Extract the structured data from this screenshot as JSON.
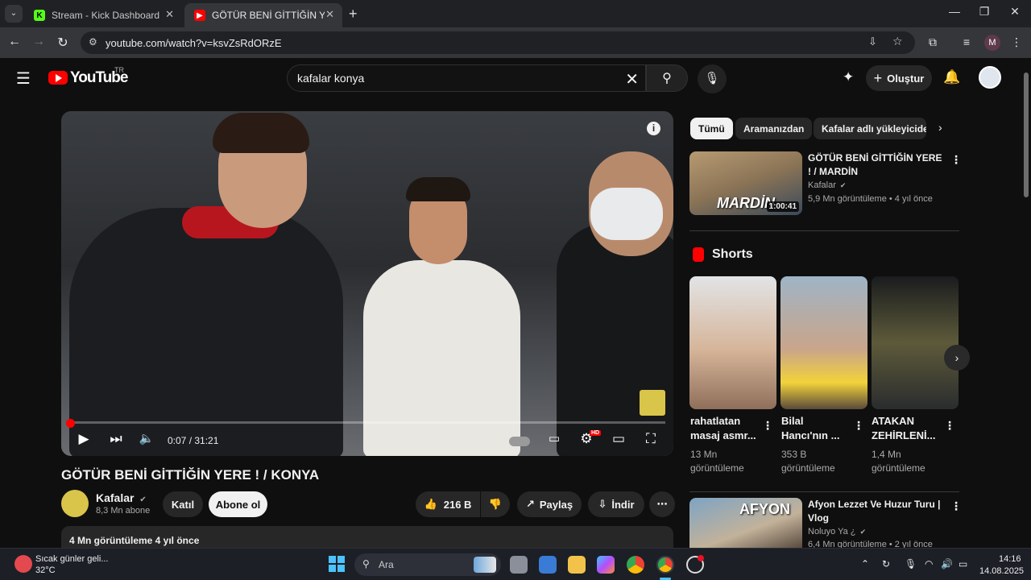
{
  "browser": {
    "tabs": [
      {
        "title": "Stream - Kick Dashboard",
        "icon": "kick-icon"
      },
      {
        "title": "GÖTÜR BENİ GİTTİĞİN YERE ! / KONYA",
        "icon": "youtube-icon"
      }
    ],
    "new_tab": "+",
    "url": "youtube.com/watch?v=ksvZsRdORzE",
    "profile_initial": "M"
  },
  "youtube": {
    "logo_text": "YouTube",
    "country_code": "TR",
    "search_query": "kafalar konya",
    "create_label": "Oluştur"
  },
  "player": {
    "time": "0:07 / 31:21",
    "progress_fraction": 0.004,
    "hd_badge": "HD"
  },
  "video": {
    "title": "GÖTÜR BENİ GİTTİĞİN YERE ! / KONYA",
    "channel": "Kafalar",
    "subscribers": "8,3 Mn abone",
    "join_label": "Katıl",
    "subscribe_label": "Abone ol",
    "likes": "216 B",
    "share_label": "Paylaş",
    "download_label": "İndir",
    "views_date": "4 Mn görüntüleme  4 yıl önce"
  },
  "sidebar": {
    "chips": [
      "Tümü",
      "Aramanızdan",
      "Kafalar adlı yükleyiciden"
    ],
    "recommended": [
      {
        "title": "GÖTÜR BENİ GİTTİĞİN YERE ! / MARDİN",
        "channel": "Kafalar",
        "meta": "5,9 Mn görüntüleme • 4 yıl önce",
        "duration": "1:00:41",
        "thumb_text": "MARDİN"
      },
      {
        "title": "Afyon Lezzet Ve Huzur Turu | Vlog",
        "channel": "Noluyo Ya ¿",
        "meta": "6,4 Mn görüntüleme • 2 yıl önce",
        "thumb_text": "AFYON"
      }
    ],
    "shorts_heading": "Shorts",
    "shorts": [
      {
        "title": "rahatlatan masaj asmr...",
        "views": "13 Mn görüntüleme"
      },
      {
        "title": "Bilal Hancı'nın ...",
        "views": "353 B görüntüleme"
      },
      {
        "title": "ATAKAN ZEHİRLENİ...",
        "views": "1,4 Mn görüntüleme"
      }
    ]
  },
  "taskbar": {
    "weather_title": "Sıcak günler geli...",
    "weather_temp": "32°C",
    "search_label": "Ara",
    "time": "14:16",
    "date": "14.08.2025"
  },
  "colors": {
    "yt_red": "#ff0000",
    "bg": "#0f0f0f",
    "chrome_dark": "#202124",
    "chrome_mid": "#35363a"
  }
}
